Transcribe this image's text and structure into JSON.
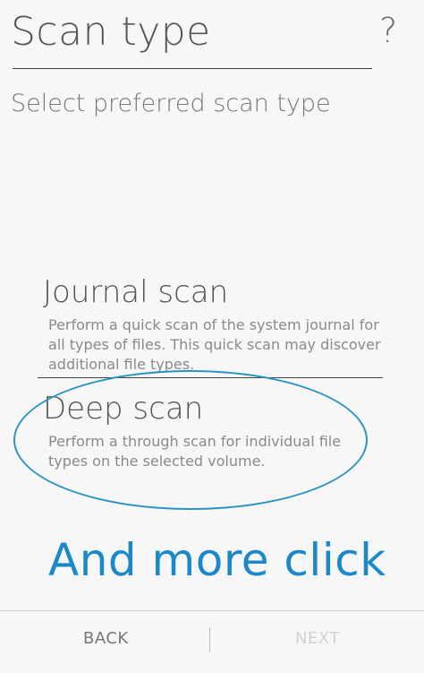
{
  "header": {
    "title": "Scan type",
    "help": "?"
  },
  "subtitle": "Select preferred scan type",
  "options": [
    {
      "title": "Journal scan",
      "description": "Perform a quick scan of the system journal for all types of files. This quick scan may discover additional file types."
    },
    {
      "title": "Deep scan",
      "description": "Perform a through scan for individual file types on the selected volume."
    }
  ],
  "annotation": {
    "text": "And more click",
    "color": "#1a88c9"
  },
  "footer": {
    "back_label": "BACK",
    "next_label": "NEXT"
  }
}
